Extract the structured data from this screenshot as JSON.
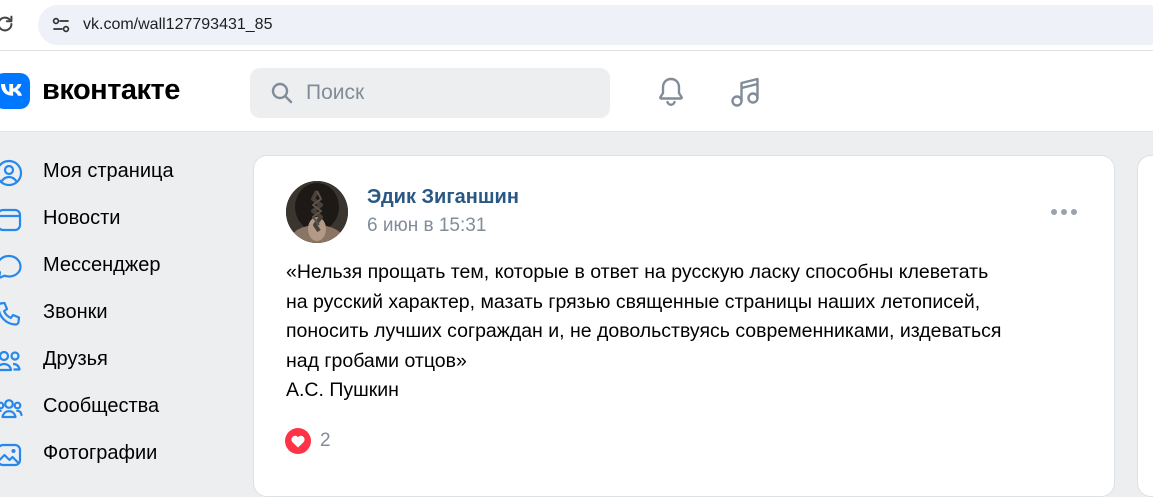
{
  "browser": {
    "url": "vk.com/wall127793431_85"
  },
  "header": {
    "logo_text": "вконтакте",
    "search_placeholder": "Поиск",
    "brand_color": "#0077ff"
  },
  "sidebar": {
    "items": [
      {
        "label": "Моя страница",
        "icon": "user-circle-icon"
      },
      {
        "label": "Новости",
        "icon": "news-icon"
      },
      {
        "label": "Мессенджер",
        "icon": "message-icon"
      },
      {
        "label": "Звонки",
        "icon": "phone-icon"
      },
      {
        "label": "Друзья",
        "icon": "friends-icon"
      },
      {
        "label": "Сообщества",
        "icon": "communities-icon"
      },
      {
        "label": "Фотографии",
        "icon": "photo-icon"
      }
    ]
  },
  "post": {
    "author": "Эдик Зиганшин",
    "date": "6 июн в 15:31",
    "text_lines": [
      "«Нельзя прощать тем, которые в ответ на русскую ласку способны клеветать",
      "на русский характер, мазать грязью священные страницы наших летописей,",
      "поносить лучших сограждан и, не довольствуясь современниками, издеваться",
      "над гробами отцов»",
      "А.С. Пушкин"
    ],
    "likes": "2",
    "like_color": "#ff3347"
  }
}
